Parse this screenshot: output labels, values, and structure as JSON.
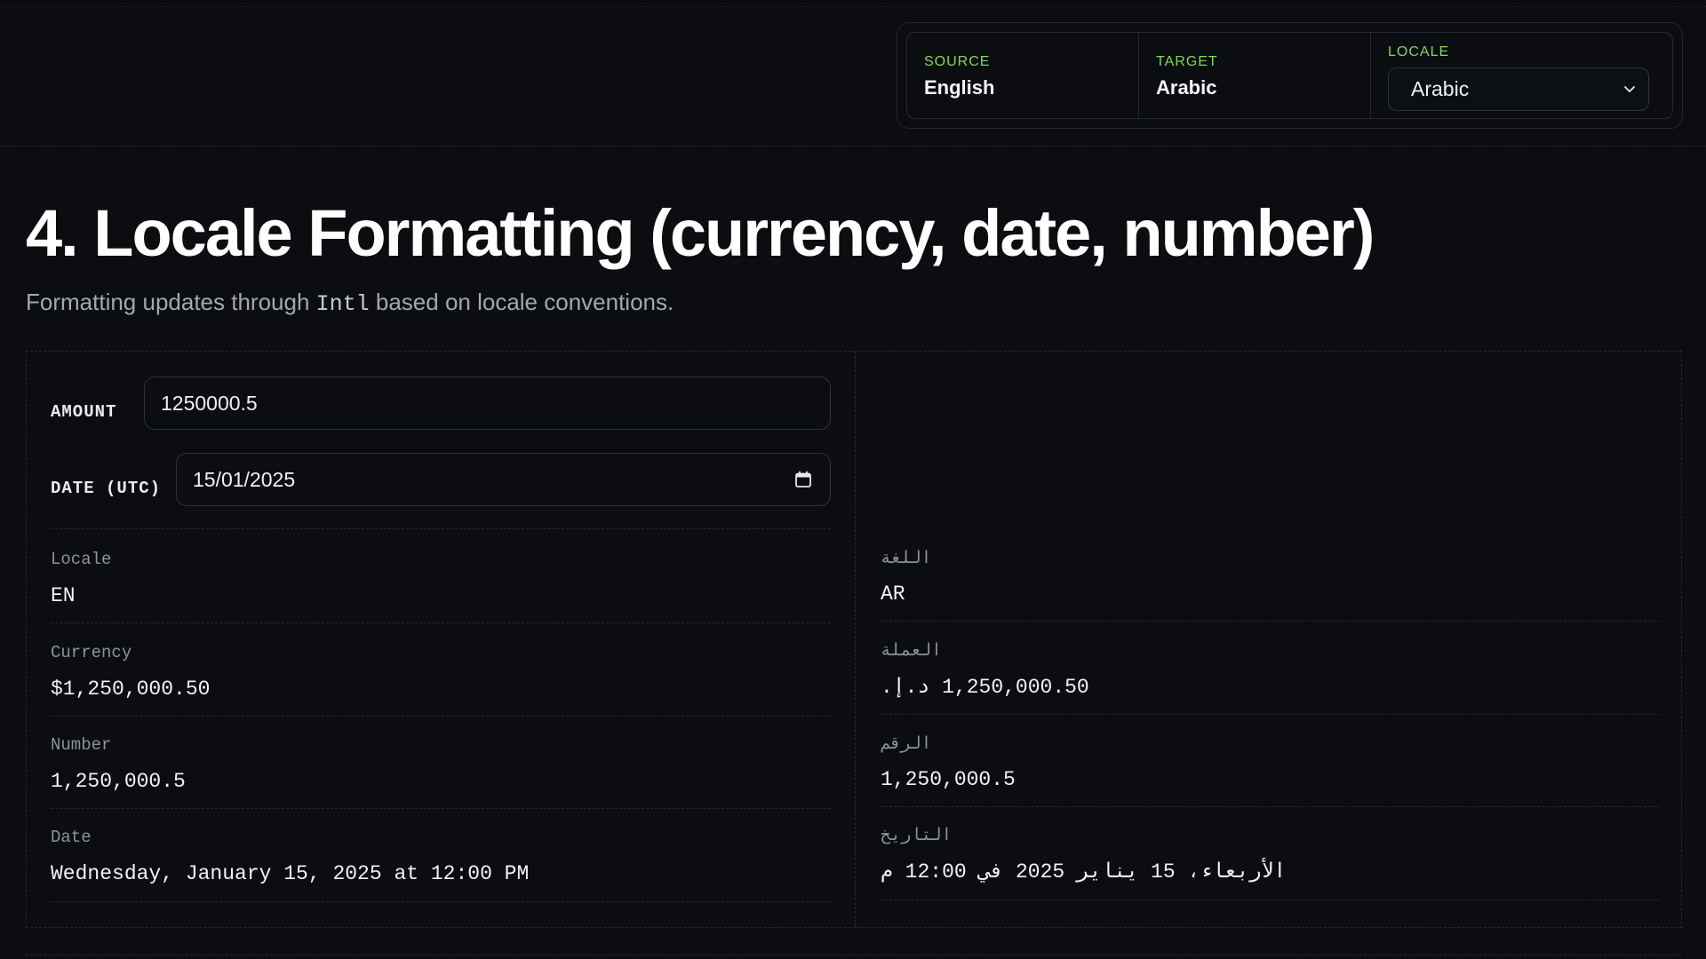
{
  "header": {
    "source_label": "SOURCE",
    "source_value": "English",
    "target_label": "TARGET",
    "target_value": "Arabic",
    "locale_label": "LOCALE",
    "locale_selected": "Arabic"
  },
  "page": {
    "title": "4. Locale Formatting (currency, date, number)",
    "subtitle_pre": "Formatting updates through ",
    "subtitle_code": "Intl",
    "subtitle_post": " based on locale conventions."
  },
  "inputs": {
    "amount_label": "AMOUNT",
    "amount_value": "1250000.5",
    "date_label": "DATE (UTC)",
    "date_value": "15/01/2025"
  },
  "source_output": {
    "locale_label": "Locale",
    "locale_value": "EN",
    "currency_label": "Currency",
    "currency_value": "$1,250,000.50",
    "number_label": "Number",
    "number_value": "1,250,000.5",
    "date_label": "Date",
    "date_value": "Wednesday, January 15, 2025 at 12:00 PM"
  },
  "target_output": {
    "locale_label": "اللغة",
    "locale_value": "AR",
    "currency_label": "العملة",
    "currency_value": "‏1,250,000.50 د.إ.‏",
    "number_label": "الرقم",
    "number_value": "1,250,000.5",
    "date_label": "التاريخ",
    "date_value": "الأربعاء، 15 يناير 2025 في 12:00 م"
  },
  "colors": {
    "accent_green": "#7ed957",
    "background": "#0b0d10"
  },
  "icons": {
    "select": "chevron-down-icon",
    "date": "calendar-icon"
  }
}
